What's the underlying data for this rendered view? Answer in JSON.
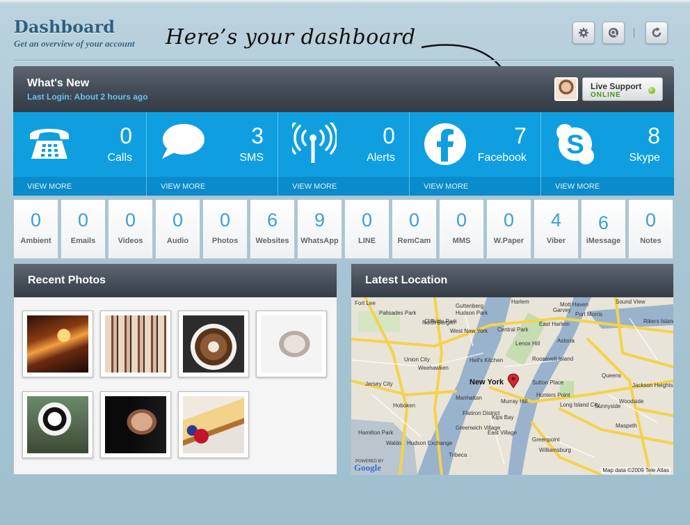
{
  "header": {
    "title": "Dashboard",
    "subtitle": "Get an overview of your account",
    "annotation": "Here’s your dashboard"
  },
  "toolbar": {
    "settings_icon": "gear-icon",
    "search_icon": "search-icon",
    "refresh_icon": "refresh-icon"
  },
  "whats_new": {
    "title": "What's New",
    "last_login": "Last Login: About 2 hours ago",
    "support_label": "Live Support",
    "support_status": "ONLINE",
    "status_color": "#5fa51b"
  },
  "stats": [
    {
      "count": "0",
      "label": "Calls",
      "more": "VIEW MORE",
      "icon": "phone-icon"
    },
    {
      "count": "3",
      "label": "SMS",
      "more": "VIEW MORE",
      "icon": "chat-bubble-icon"
    },
    {
      "count": "0",
      "label": "Alerts",
      "more": "VIEW MORE",
      "icon": "antenna-icon"
    },
    {
      "count": "7",
      "label": "Facebook",
      "more": "VIEW MORE",
      "icon": "facebook-icon"
    },
    {
      "count": "8",
      "label": "Skype",
      "more": "VIEW MORE",
      "icon": "skype-icon"
    }
  ],
  "counters": [
    {
      "value": "0",
      "label": "Ambient"
    },
    {
      "value": "0",
      "label": "Emails"
    },
    {
      "value": "0",
      "label": "Videos"
    },
    {
      "value": "0",
      "label": "Audio"
    },
    {
      "value": "0",
      "label": "Photos"
    },
    {
      "value": "6",
      "label": "Websites"
    },
    {
      "value": "9",
      "label": "WhatsApp"
    },
    {
      "value": "0",
      "label": "LINE"
    },
    {
      "value": "0",
      "label": "RemCam"
    },
    {
      "value": "0",
      "label": "MMS"
    },
    {
      "value": "0",
      "label": "W.Paper"
    },
    {
      "value": "4",
      "label": "Viber"
    },
    {
      "value": "6",
      "label": "iMessage"
    },
    {
      "value": "0",
      "label": "Notes"
    }
  ],
  "recent_photos": {
    "title": "Recent Photos",
    "photos": [
      "bar-storefront-photo",
      "vintage-fashion-photo",
      "latte-art-photo",
      "kitten-photo",
      "panda-photo",
      "portrait-photo",
      "cheesecake-photo"
    ]
  },
  "location": {
    "title": "Latest Location",
    "city": "New York",
    "labels": [
      "Fort Lee",
      "Palisades Park",
      "Cliffside Park",
      "North Bergen",
      "Guttenberg",
      "West New York",
      "Union City",
      "Weehawken",
      "Jersey City",
      "Hoboken",
      "Hamilton Park",
      "Waldo",
      "Hudson Exchange",
      "Manhattan",
      "Murray Hill",
      "Sutton Place",
      "Hunters Point",
      "Queens",
      "Astoria",
      "Long Island City",
      "Sunnyside",
      "Woodside",
      "Jackson Heights",
      "Maspeth",
      "Greenpoint",
      "Williamsburg",
      "East Village",
      "Greenwich Village",
      "Kips Bay",
      "Flatiron District",
      "Lenox Hill",
      "Hell's Kitchen",
      "Central Park",
      "Roosevelt Island",
      "Rikers Island",
      "Tribeca",
      "Mott Haven",
      "Port Morris",
      "Garvey",
      "Sound View",
      "Harlem",
      "Hudson Park",
      "East Harlem"
    ],
    "attribution": "Map data ©2009 Tele Atlas",
    "logo": "Google",
    "powered": "POWERED BY"
  }
}
